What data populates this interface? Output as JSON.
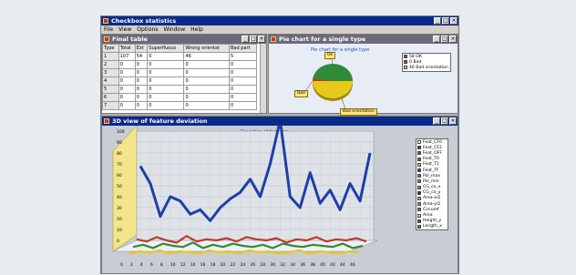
{
  "app": {
    "title": "Checkbox statistics",
    "menu": [
      "File",
      "View",
      "Options",
      "Window",
      "Help"
    ]
  },
  "table_window": {
    "title": "Final table",
    "columns": [
      "Type",
      "Total",
      "Ext",
      "Superfluous",
      "Wrong orientat",
      "Bad part"
    ],
    "rows": [
      [
        "1",
        "107",
        "54",
        "0",
        "46",
        "5"
      ],
      [
        "2",
        "0",
        "0",
        "0",
        "0",
        "0"
      ],
      [
        "3",
        "0",
        "0",
        "0",
        "0",
        "0"
      ],
      [
        "4",
        "0",
        "0",
        "0",
        "0",
        "0"
      ],
      [
        "5",
        "0",
        "0",
        "0",
        "0",
        "0"
      ],
      [
        "6",
        "0",
        "0",
        "0",
        "0",
        "0"
      ],
      [
        "7",
        "0",
        "0",
        "0",
        "0",
        "0"
      ]
    ]
  },
  "pie_window": {
    "title": "Pie chart for a single type",
    "chart_title": "Pie chart for a single type",
    "callouts": {
      "ok": "Ok",
      "bad": "Bad",
      "wrong": "Bad orientation"
    },
    "legend": [
      {
        "label": "58 OK",
        "color": "#2e8b3a"
      },
      {
        "label": "0 Bad",
        "color": "#c0392b"
      },
      {
        "label": "46 Bad orientation",
        "color": "#e8c81a"
      }
    ]
  },
  "chart3d_window": {
    "title": "3D view of feature deviation",
    "chart_title": "Deviation of features",
    "legend": [
      "Feat_CF0",
      "Feat_CF2",
      "Feat_OFF",
      "Feat_T0",
      "Feat_T1",
      "Feat_TF",
      "Pol_max",
      "Pol_min",
      "CG_co_x",
      "CG_co_y",
      "Area-x/2",
      "Area-y/2",
      "Circumf",
      "Area",
      "Height_y",
      "Length_x"
    ]
  },
  "chart_data": {
    "type": "line",
    "title": "Deviation of features",
    "x": [
      0,
      2,
      4,
      6,
      8,
      10,
      12,
      14,
      16,
      18,
      20,
      22,
      24,
      26,
      28,
      30,
      32,
      34,
      36,
      38,
      40,
      42,
      44,
      46
    ],
    "ylim": [
      0,
      100
    ],
    "yticks": [
      0,
      10,
      20,
      30,
      40,
      50,
      60,
      70,
      80,
      90,
      100
    ],
    "series": [
      {
        "name": "Feat_CF0",
        "color": "#1e3fa8",
        "values": [
          68,
          52,
          22,
          40,
          36,
          24,
          28,
          18,
          30,
          38,
          44,
          56,
          40,
          70,
          110,
          40,
          30,
          62,
          34,
          46,
          28,
          52,
          36,
          80
        ]
      },
      {
        "name": "Feat_CF2",
        "color": "#c0392b",
        "values": [
          6,
          4,
          8,
          5,
          3,
          9,
          4,
          6,
          5,
          7,
          4,
          8,
          6,
          5,
          7,
          3,
          6,
          5,
          8,
          4,
          6,
          5,
          7,
          4
        ]
      },
      {
        "name": "Feat_OFF",
        "color": "#2e8b3a",
        "values": [
          4,
          6,
          3,
          7,
          5,
          4,
          8,
          3,
          6,
          4,
          7,
          5,
          4,
          6,
          3,
          7,
          5,
          4,
          6,
          5,
          4,
          7,
          3,
          5
        ]
      },
      {
        "name": "Area",
        "color": "#e8c81a",
        "values": [
          3,
          5,
          4,
          6,
          3,
          5,
          4,
          3,
          6,
          4,
          5,
          3,
          6,
          4,
          5,
          3,
          4,
          6,
          3,
          5,
          4,
          3,
          5,
          4
        ]
      }
    ]
  }
}
